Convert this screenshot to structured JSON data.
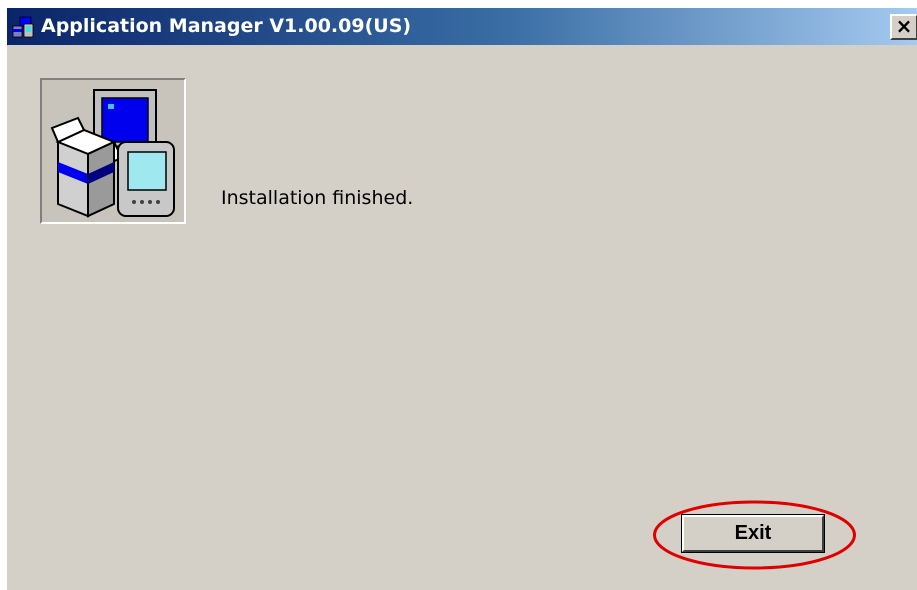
{
  "window": {
    "title": "Application Manager V1.00.09(US)",
    "close_label": "×"
  },
  "main": {
    "message": "Installation finished.",
    "exit_label": "Exit"
  },
  "annotation": {
    "highlight_color": "#e00000"
  },
  "colors": {
    "titlebar_start": "#0a246a",
    "titlebar_end": "#a6caf0",
    "window_bg": "#d4d0c8"
  },
  "icons": {
    "title_icon": "application-manager-icon",
    "app_image": "install-package-devices-icon"
  }
}
